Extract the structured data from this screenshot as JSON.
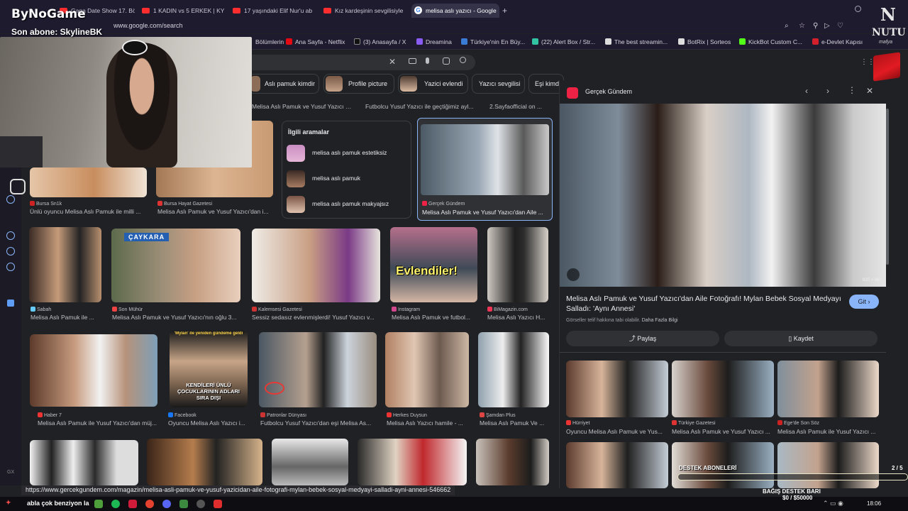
{
  "overlay": {
    "logo": "ByNoGame",
    "last_sub": "Son abone: SkylineBK",
    "right_logo": "NUTU",
    "right_logo_sub": "mafya",
    "donation_header": "DESTEK ABONELERİ",
    "donation_page": "2 / 5",
    "donation_bar_title": "BAĞIŞ DESTEK BARI",
    "donation_bar_value": "$0 / $50000",
    "ticker": "abla çok benziyon la"
  },
  "tabs": [
    {
      "label": "Gaga Date Show 17. Bölü"
    },
    {
      "label": "1 KADIN vs 5 ERKEK | KY"
    },
    {
      "label": "17 yaşındaki Elif Nur'u ab"
    },
    {
      "label": "Kız kardeşinin sevgilisiyle"
    },
    {
      "label": "melisa aslı yazıcı - Google"
    }
  ],
  "address": "www.google.com/search",
  "bookmarks": [
    {
      "label": "Bölümlerin",
      "color": "#3a7bd5"
    },
    {
      "label": "Ana Sayfa - Netflix",
      "color": "#e50914"
    },
    {
      "label": "(3) Anasayfa / X",
      "color": "#000000"
    },
    {
      "label": "Dreamina",
      "color": "#8a5cf6"
    },
    {
      "label": "Türkiye'nin En Büy...",
      "color": "#3a7bd5"
    },
    {
      "label": "(22) Alert Box / Str...",
      "color": "#31c3a2"
    },
    {
      "label": "The best streamin...",
      "color": "#ffffff"
    },
    {
      "label": "BotRix | Sorteos",
      "color": "#ffffff"
    },
    {
      "label": "KickBot Custom C...",
      "color": "#53fc18"
    },
    {
      "label": "e-Devlet Kapısı",
      "color": "#d21f2b"
    }
  ],
  "chips": [
    {
      "label": "Aslı pamuk kimdir"
    },
    {
      "label": "Profile picture"
    },
    {
      "label": "Yazici evlendi"
    },
    {
      "label": "Yazıcı sevgilisi"
    },
    {
      "label": "Eşi kimdi"
    }
  ],
  "row0_titles": [
    "Melisa Aslı Pamuk ve Yusuf Yazıcı Pari...",
    "Futbolcu Yusuf Yazıcı ile geçtiğimiz ayl...",
    "2.Sayfaofficial on ..."
  ],
  "related": {
    "header": "İlgili aramalar",
    "items": [
      "melisa aslı pamuk estetiksiz",
      "melisa aslı pamuk",
      "melisa aslı pamuk makyajsız"
    ]
  },
  "row1": [
    {
      "source": "Bursa Sn1k",
      "title": "Ünlü oyuncu Melisa Aslı Pamuk ile milli ..."
    },
    {
      "source": "Bursa Hayat Gazetesi",
      "title": "Melisa Aslı Pamuk ve Yusuf Yazıcı'dan i..."
    },
    {
      "source": "Gerçek Gündem",
      "title": "Melisa Aslı Pamuk ve Yusuf Yazıcı'dan Aile ..."
    }
  ],
  "row2": [
    {
      "source": "Sabah",
      "title": "Melisa Aslı Pamuk ile ..."
    },
    {
      "source": "Son Mühür",
      "title": "Melisa Aslı Pamuk ve Yusuf Yazıcı'nın oğlu 3..."
    },
    {
      "source": "Kalemsesi Gazetesi",
      "title": "Sessiz sedasız evlenmişlerdi! Yusuf Yazıcı v..."
    },
    {
      "source": "Instagram",
      "title": "Melisa Aslı Pamuk ve futbol..."
    },
    {
      "source": "BiMagazin.com",
      "title": "Melisa Aslı Yazıcı H..."
    }
  ],
  "row2_overlay": "Evlendiler!",
  "caykara": "ÇAYKARA",
  "row3": [
    {
      "source": "Haber 7",
      "title": "Melisa Aslı Pamuk ile Yusuf Yazıcı'dan müj..."
    },
    {
      "source": "Facebook",
      "title": "Oyuncu Melisa Aslı Yazıcı i..."
    },
    {
      "source": "Patronlar Dünyası",
      "title": "Futbolcu Yusuf Yazıcı'dan eşi Melisa As..."
    },
    {
      "source": "Herkes Duysun",
      "title": "Melisa Aslı Yazıcı hamile - ..."
    },
    {
      "source": "Şamdan Plus",
      "title": "Melisa Aslı Pamuk Ve ..."
    }
  ],
  "row3_overlay_top": "'Mylan' ile yeniden gündeme geldi",
  "row3_overlay_bottom": "KENDİLERİ ÜNLÜ ÇOCUKLARININ ADLARI SIRA DIŞI",
  "panel": {
    "source": "Gerçek Gündem",
    "size": "820 × 461",
    "title": "Melisa Aslı Pamuk ve Yusuf Yazıcı'dan Aile Fotoğrafı! Mylan Bebek Sosyal Medyayı Salladı: 'Aynı Annesi'",
    "visit": "Git",
    "copyright": "Görseller telif hakkına tabi olabilir.",
    "more_info": "Daha Fazla Bilgi",
    "share": "Paylaş",
    "save": "Kaydet",
    "related": [
      {
        "source": "Hürriyet",
        "title": "Oyuncu Melisa Aslı Pamuk ve Yus..."
      },
      {
        "source": "Türkiye Gazetesi",
        "title": "Melisa Aslı Pamuk ve Yusuf Yazıcı ..."
      },
      {
        "source": "Ege'de Son Söz",
        "title": "Melisa Aslı Pamuk ile Yusuf Yazıcı ..."
      }
    ]
  },
  "status_url": "https://www.gercekgundem.com/magazin/melisa-asli-pamuk-ve-yusuf-yazicidan-aile-fotografi-mylan-bebek-sosyal-medyayi-salladi-ayni-annesi-546662",
  "taskbar": {
    "time": "18:06"
  }
}
